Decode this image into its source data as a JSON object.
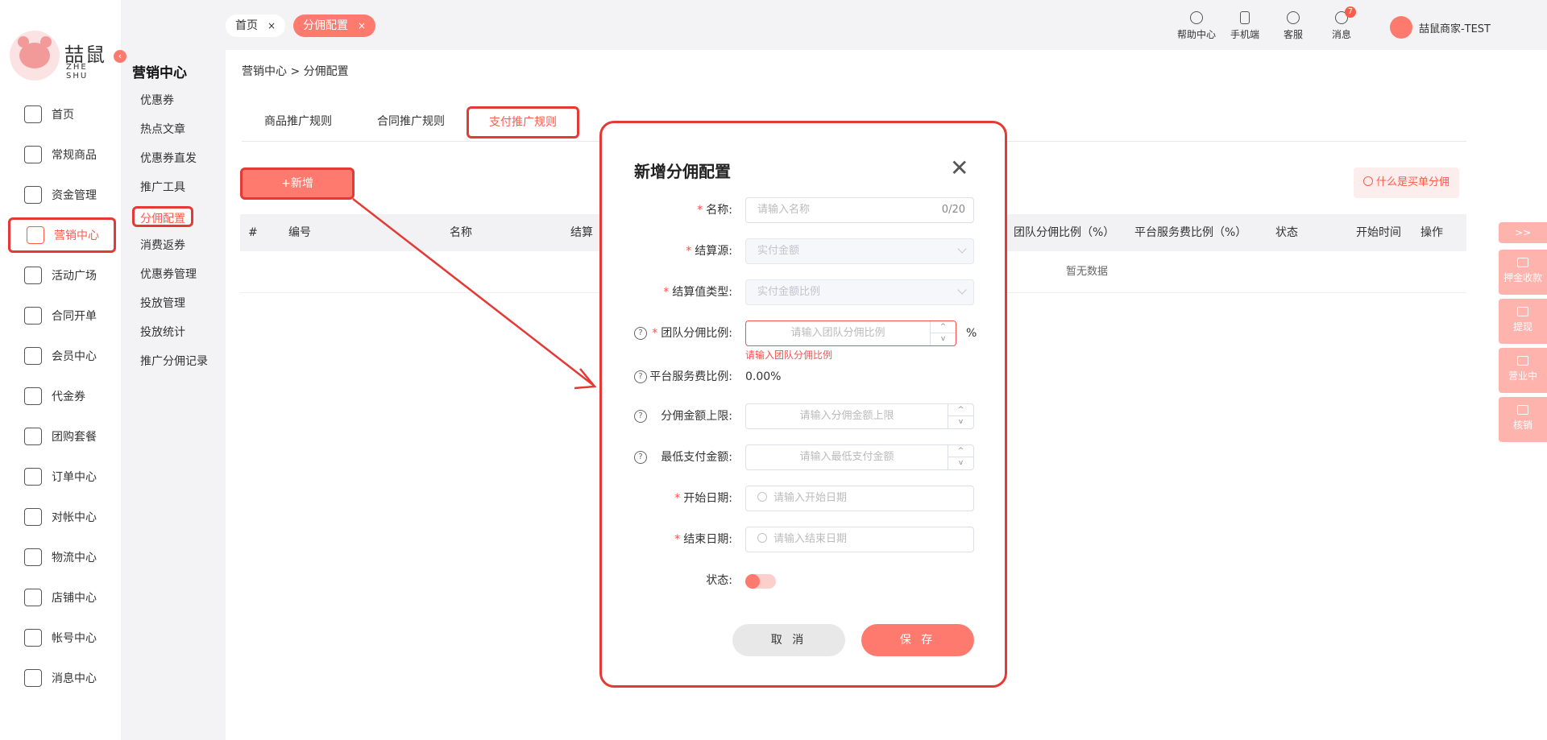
{
  "app": {
    "logo_text": "喆鼠",
    "logo_sub": "ZHE SHU",
    "collapse_glyph": "‹"
  },
  "sidebar": {
    "items": [
      {
        "label": "首页",
        "icon": "home-icon"
      },
      {
        "label": "常规商品",
        "icon": "cart-icon"
      },
      {
        "label": "资金管理",
        "icon": "layers-icon"
      },
      {
        "label": "营销中心",
        "icon": "marketing-icon",
        "active": true
      },
      {
        "label": "活动广场",
        "icon": "box-icon"
      },
      {
        "label": "合同开单",
        "icon": "contract-icon"
      },
      {
        "label": "会员中心",
        "icon": "vip-icon"
      },
      {
        "label": "代金券",
        "icon": "ticket-icon"
      },
      {
        "label": "团购套餐",
        "icon": "tag-icon"
      },
      {
        "label": "订单中心",
        "icon": "order-icon"
      },
      {
        "label": "对帐中心",
        "icon": "yen-icon"
      },
      {
        "label": "物流中心",
        "icon": "package-icon"
      },
      {
        "label": "店铺中心",
        "icon": "store-icon"
      },
      {
        "label": "帐号中心",
        "icon": "user-icon"
      },
      {
        "label": "消息中心",
        "icon": "message-icon"
      }
    ]
  },
  "subnav": {
    "title": "营销中心",
    "items": [
      "优惠券",
      "热点文章",
      "优惠券直发",
      "推广工具",
      "分佣配置",
      "消费返券",
      "优惠券管理",
      "投放管理",
      "投放统计",
      "推广分佣记录"
    ]
  },
  "topbar": {
    "tabs": [
      {
        "label": "首页",
        "close": "×"
      },
      {
        "label": "分佣配置",
        "close": "×"
      }
    ],
    "tools": [
      {
        "label": "帮助中心",
        "icon": "help-icon"
      },
      {
        "label": "手机端",
        "icon": "phone-icon"
      },
      {
        "label": "客服",
        "icon": "headset-icon"
      },
      {
        "label": "消息",
        "icon": "chat-icon",
        "badge": "7"
      }
    ],
    "user_name": "喆鼠商家-TEST"
  },
  "main": {
    "breadcrumb": "营销中心 > 分佣配置",
    "rule_tabs": [
      "商品推广规则",
      "合同推广规则",
      "支付推广规则"
    ],
    "add_button": "+新增",
    "help_link": "什么是买单分佣",
    "table": {
      "columns": [
        "#",
        "编号",
        "名称",
        "结算",
        "团队分佣比例（%）",
        "平台服务费比例（%）",
        "状态",
        "开始时间",
        "操作"
      ],
      "empty_text": "暂无数据"
    }
  },
  "float_panel": {
    "toggle": ">>",
    "items": [
      "押金收款",
      "提现",
      "营业中",
      "核销"
    ]
  },
  "modal": {
    "title": "新增分佣配置",
    "close": "✕",
    "fields": {
      "name": {
        "label": "名称:",
        "placeholder": "请输入名称",
        "counter": "0/20"
      },
      "settle_source": {
        "label": "结算源:",
        "value": "实付金额"
      },
      "settle_type": {
        "label": "结算值类型:",
        "value": "实付金额比例"
      },
      "team_ratio": {
        "label": "团队分佣比例:",
        "placeholder": "请输入团队分佣比例",
        "unit": "%",
        "error": "请输入团队分佣比例"
      },
      "platform_ratio": {
        "label": "平台服务费比例:",
        "value": "0.00%"
      },
      "max_amount": {
        "label": "分佣金额上限:",
        "placeholder": "请输入分佣金额上限"
      },
      "min_pay": {
        "label": "最低支付金额:",
        "placeholder": "请输入最低支付金额"
      },
      "start_date": {
        "label": "开始日期:",
        "placeholder": "请输入开始日期"
      },
      "end_date": {
        "label": "结束日期:",
        "placeholder": "请输入结束日期"
      },
      "status": {
        "label": "状态:"
      }
    },
    "required_mark": "*",
    "help_glyph": "?",
    "spin_up": "^",
    "spin_down": "v",
    "cancel": "取 消",
    "save": "保 存"
  },
  "colors": {
    "accent": "#ff7a6e",
    "highlight_border": "#e53935",
    "error": "#ff4d4f"
  }
}
